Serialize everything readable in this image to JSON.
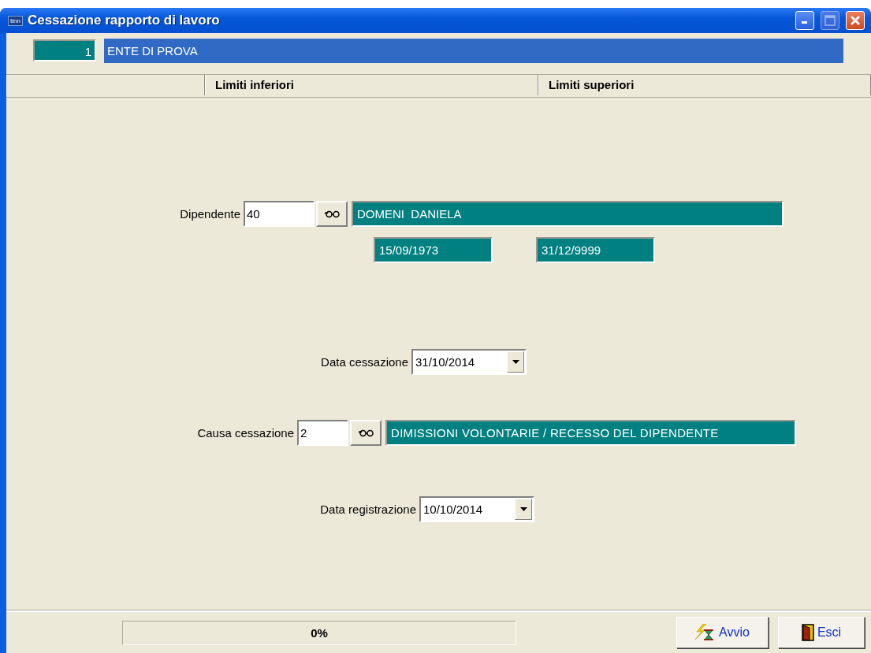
{
  "window": {
    "title": "Cessazione rapporto di lavoro",
    "app_badge": "tinn"
  },
  "ente": {
    "code": "1",
    "name": "ENTE DI PROVA"
  },
  "header": {
    "columns": [
      "Limiti inferiori",
      "Limiti superiori"
    ]
  },
  "dipendente": {
    "label": "Dipendente",
    "value": "40",
    "name": "DOMENI  DANIELA",
    "date_from": "15/09/1973",
    "date_to": "31/12/9999"
  },
  "data_cessazione": {
    "label": "Data cessazione",
    "value": "31/10/2014"
  },
  "causa": {
    "label": "Causa cessazione",
    "value": "2",
    "description": "DIMISSIONI VOLONTARIE / RECESSO DEL DIPENDENTE"
  },
  "data_registrazione": {
    "label": "Data registrazione",
    "value": "10/10/2014"
  },
  "progress": {
    "level": 0,
    "reading": "0%"
  },
  "buttons": [
    {
      "label": "Avvio",
      "kind": "start"
    },
    {
      "label": "Esci",
      "kind": "exit"
    }
  ]
}
